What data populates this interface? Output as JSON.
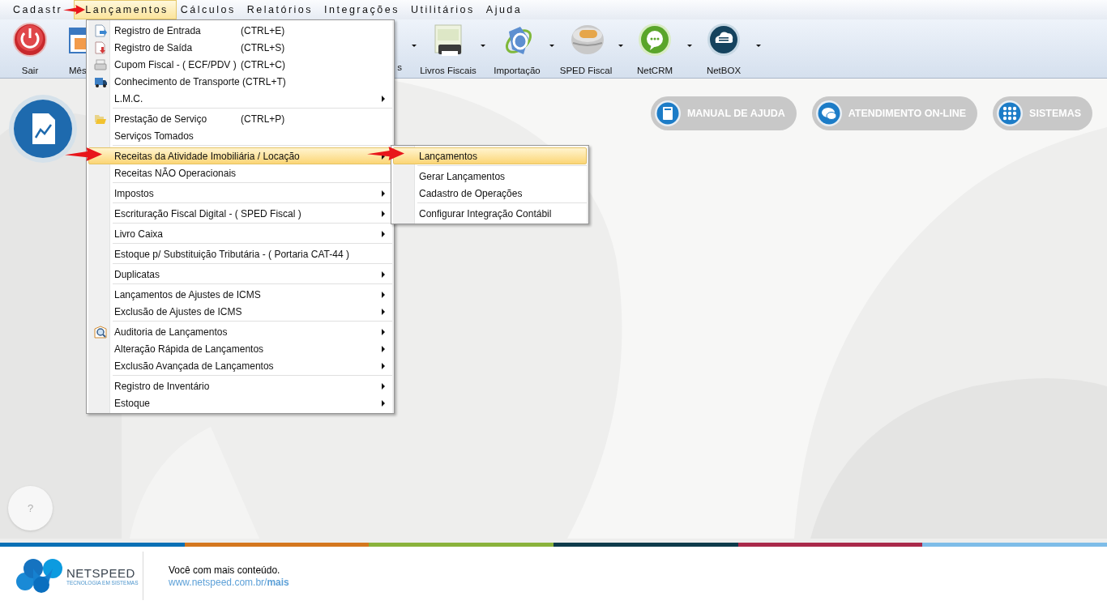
{
  "menu_bar": [
    {
      "label": "Cadastr",
      "selected": false
    },
    {
      "label": "Lançamentos",
      "selected": true
    },
    {
      "label": "Cálculos",
      "selected": false
    },
    {
      "label": "Relatórios",
      "selected": false
    },
    {
      "label": "Integrações",
      "selected": false
    },
    {
      "label": "Utilitários",
      "selected": false
    },
    {
      "label": "Ajuda",
      "selected": false
    }
  ],
  "toolbar": [
    {
      "label": "Sair",
      "kind": "power",
      "dropdown": false
    },
    {
      "label": "Mês",
      "kind": "calendar",
      "dropdown": false
    },
    {
      "label": "s",
      "kind": "hidden",
      "dropdown": true
    },
    {
      "label": "Livros Fiscais",
      "kind": "printer",
      "dropdown": true
    },
    {
      "label": "Importação",
      "kind": "ring",
      "dropdown": true
    },
    {
      "label": "SPED Fiscal",
      "kind": "sphere",
      "dropdown": true
    },
    {
      "label": "NetCRM",
      "kind": "chat",
      "dropdown": true
    },
    {
      "label": "NetBOX",
      "kind": "cloud",
      "dropdown": true
    }
  ],
  "menu": {
    "groups": [
      {
        "items": [
          {
            "label": "Registro de Entrada",
            "shortcut": "(CTRL+E)",
            "kind": "doc_in",
            "submenu": false,
            "selected": false
          },
          {
            "label": "Registro de Saída",
            "shortcut": "(CTRL+S)",
            "kind": "doc_out",
            "submenu": false,
            "selected": false
          },
          {
            "label": "Cupom Fiscal - ( ECF/PDV )",
            "shortcut": "(CTRL+C)",
            "kind": "printer",
            "submenu": false,
            "selected": false
          },
          {
            "label": "Conhecimento de Transporte (CTRL+T)",
            "kind": "truck",
            "submenu": false,
            "selected": false
          },
          {
            "label": "L.M.C.",
            "kind": "plain",
            "submenu": true,
            "selected": false
          }
        ]
      },
      {
        "items": [
          {
            "label": "Prestação de Serviço",
            "shortcut": "(CTRL+P)",
            "kind": "folder",
            "submenu": false,
            "selected": false
          },
          {
            "label": "Serviços Tomados",
            "kind": "plain",
            "submenu": false,
            "selected": false
          }
        ]
      },
      {
        "items": [
          {
            "label": "Receitas da Atividade Imobiliária / Locação",
            "kind": "plain",
            "submenu": true,
            "selected": true
          },
          {
            "label": "Receitas NÃO Operacionais",
            "kind": "plain",
            "submenu": false,
            "selected": false
          }
        ]
      },
      {
        "items": [
          {
            "label": "Impostos",
            "kind": "plain",
            "submenu": true,
            "selected": false
          }
        ]
      },
      {
        "items": [
          {
            "label": "Escrituração Fiscal Digital - ( SPED Fiscal )",
            "kind": "plain",
            "submenu": true,
            "selected": false
          }
        ]
      },
      {
        "items": [
          {
            "label": "Livro Caixa",
            "kind": "plain",
            "submenu": true,
            "selected": false
          }
        ]
      },
      {
        "items": [
          {
            "label": "Estoque p/ Substituição Tributária - ( Portaria CAT-44 )",
            "kind": "plain",
            "submenu": false,
            "selected": false
          }
        ]
      },
      {
        "items": [
          {
            "label": "Duplicatas",
            "kind": "plain",
            "submenu": true,
            "selected": false
          }
        ]
      },
      {
        "items": [
          {
            "label": "Lançamentos de Ajustes de ICMS",
            "kind": "plain",
            "submenu": true,
            "selected": false
          },
          {
            "label": "Exclusão de Ajustes de ICMS",
            "kind": "plain",
            "submenu": true,
            "selected": false
          }
        ]
      },
      {
        "items": [
          {
            "label": "Auditoria de Lançamentos",
            "kind": "magnifier",
            "submenu": true,
            "selected": false
          },
          {
            "label": "Alteração Rápida de Lançamentos",
            "kind": "plain",
            "submenu": true,
            "selected": false
          },
          {
            "label": "Exclusão Avançada de Lançamentos",
            "kind": "plain",
            "submenu": true,
            "selected": false
          }
        ]
      },
      {
        "items": [
          {
            "label": "Registro de Inventário",
            "kind": "plain",
            "submenu": true,
            "selected": false
          },
          {
            "label": "Estoque",
            "kind": "plain",
            "submenu": true,
            "selected": false
          }
        ]
      }
    ]
  },
  "submenu": {
    "groups": [
      {
        "items": [
          {
            "label": "Lançamentos",
            "submenu": false,
            "selected": true
          }
        ]
      },
      {
        "items": [
          {
            "label": "Gerar Lançamentos",
            "submenu": false,
            "selected": false
          },
          {
            "label": "Cadastro de Operações",
            "submenu": false,
            "selected": false
          }
        ]
      },
      {
        "items": [
          {
            "label": "Configurar Integração Contábil",
            "submenu": false,
            "selected": false
          }
        ]
      }
    ]
  },
  "home_buttons": [
    {
      "label": "MANUAL DE AJUDA",
      "kind": "book"
    },
    {
      "label": "ATENDIMENTO ON-LINE",
      "kind": "chat"
    },
    {
      "label": "SISTEMAS",
      "kind": "grid"
    }
  ],
  "help_button": {
    "label": "?"
  },
  "footer": {
    "brand": "NETSPEED",
    "tagline": "TECNOLOGIA EM SISTEMAS",
    "message": "Você com mais conteúdo.",
    "link": "www.netspeed.com.br/**mais**"
  },
  "annotations": [
    {
      "kind": "arrow"
    },
    {
      "kind": "arrow"
    },
    {
      "kind": "arrow"
    }
  ]
}
